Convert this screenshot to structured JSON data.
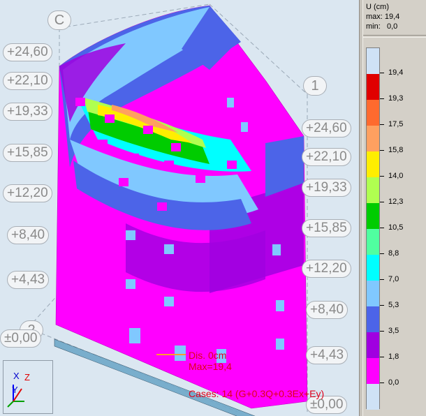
{
  "viewport": {
    "axis_labels": {
      "c": "C",
      "one": "1",
      "two": "2"
    },
    "levels_left": [
      "+24,60",
      "+22,10",
      "+19,33",
      "+15,85",
      "+12,20",
      "+8,40",
      "+4,43",
      "±0,00"
    ],
    "levels_right": [
      "+24,60",
      "+22,10",
      "+19,33",
      "+15,85",
      "+12,20",
      "+8,40",
      "+4,43",
      "±0,00"
    ],
    "overlay": {
      "dis_label": "Dis. 0cm",
      "max_label": "Max=19,4",
      "cases_label": "Cases: 14 (G+0.3Q+0.3Ex+Ey)"
    },
    "triad": {
      "x": "X",
      "y": "Y",
      "z": "Z"
    },
    "colors": {
      "background": "#dbe7f1",
      "overlay_text": "#e0001a",
      "dis_line": "#ff9a2e",
      "support_blocks": "#6fa8c9"
    }
  },
  "legend": {
    "title": "U (cm)",
    "max_text": "max: 19,4",
    "min_text": "min:   0,0",
    "colors": [
      "#cfe2f6",
      "#e00000",
      "#ff6a2e",
      "#ffa060",
      "#ffee00",
      "#b0ff50",
      "#00cc00",
      "#50ffa0",
      "#00ffff",
      "#80c8ff",
      "#4c64e8",
      "#a000e0",
      "#ff00ff",
      "#cfe2f6"
    ],
    "ticks": [
      "19,4",
      "19,3",
      "17,5",
      "15,8",
      "14,0",
      "12,3",
      "10,5",
      "8,8",
      "7,0",
      "5,3",
      "3,5",
      "1,8",
      "0,0"
    ]
  }
}
